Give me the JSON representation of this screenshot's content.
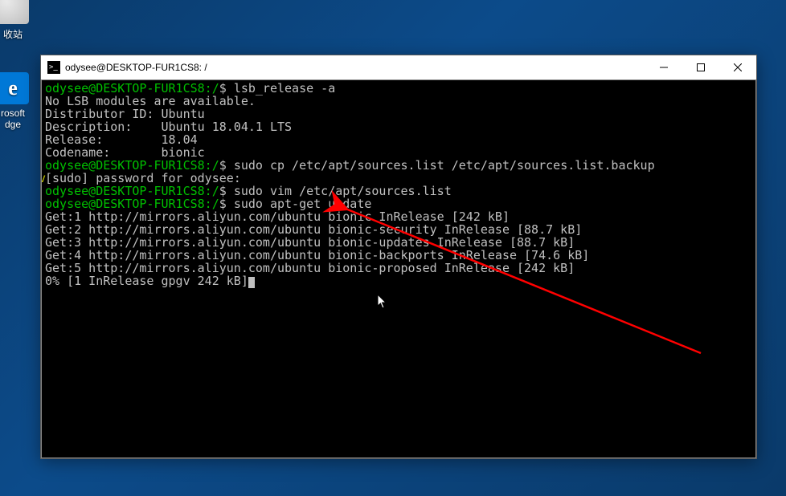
{
  "desktop": {
    "recycle_label": "收站",
    "edge_label": "rosoft\ndge",
    "edge_letter": "e"
  },
  "window": {
    "title": "odysee@DESKTOP-FUR1CS8: /"
  },
  "term": {
    "p1": "odysee@DESKTOP-FUR1CS8:/",
    "cmd1": "lsb_release -a",
    "l1": "No LSB modules are available.",
    "l2": "Distributor ID: Ubuntu",
    "l3": "Description:    Ubuntu 18.04.1 LTS",
    "l4": "Release:        18.04",
    "l5": "Codename:       bionic",
    "cmd2": "sudo cp /etc/apt/sources.list /etc/apt/sources.list.backup",
    "l6": "[sudo] password for odysee:",
    "cmd3": "sudo vim /etc/apt/sources.list",
    "cmd4": "sudo apt-get update",
    "g1": "Get:1 http://mirrors.aliyun.com/ubuntu bionic InRelease [242 kB]",
    "g2": "Get:2 http://mirrors.aliyun.com/ubuntu bionic-security InRelease [88.7 kB]",
    "g3": "Get:3 http://mirrors.aliyun.com/ubuntu bionic-updates InRelease [88.7 kB]",
    "g4": "Get:4 http://mirrors.aliyun.com/ubuntu bionic-backports InRelease [74.6 kB]",
    "g5": "Get:5 http://mirrors.aliyun.com/ubuntu bionic-proposed InRelease [242 kB]",
    "last": "0% [1 InRelease gpgv 242 kB]",
    "dollar": "$ ",
    "margin_v": "v"
  }
}
